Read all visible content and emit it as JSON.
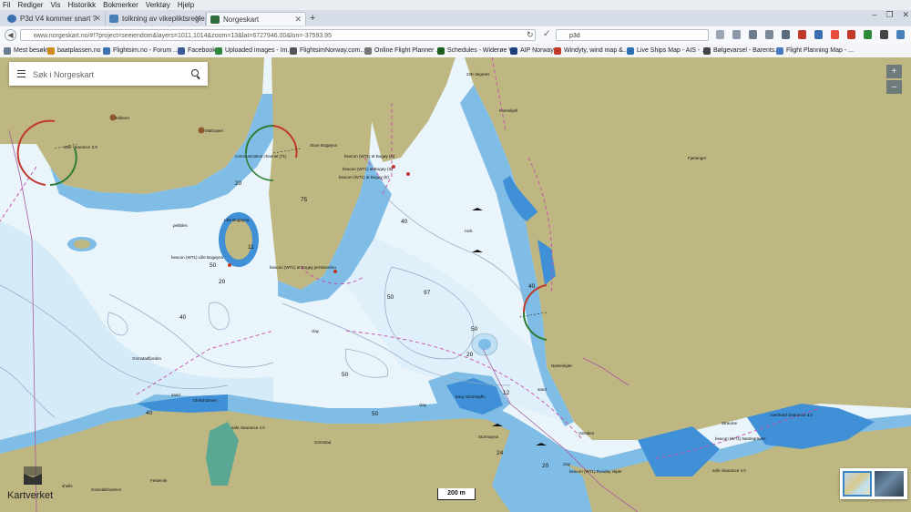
{
  "menubar": [
    "Fil",
    "Rediger",
    "Vis",
    "Historikk",
    "Bokmerker",
    "Verktøy",
    "Hjelp"
  ],
  "tabs": [
    {
      "label": "P3d V4 kommer snart ?",
      "color": "#3a6fb0"
    },
    {
      "label": "tolkning av vikepliktsreglene",
      "color": "#4a80b8"
    },
    {
      "label": "Norgeskart",
      "color": "#2f6e3a"
    }
  ],
  "new_tab": "+",
  "window_buttons": [
    "–",
    "❐",
    "✕"
  ],
  "url": "www.norgeskart.no/#!?project=seeiendom&layers=1011,1014&zoom=13&lat=6727946.00&lon=-37593.95",
  "search_engine_query": "p3d",
  "bookmarks": [
    {
      "label": "Mest besøkt",
      "color": "#6b7b8c"
    },
    {
      "label": "baatplassen.no",
      "color": "#d08a1a"
    },
    {
      "label": "Flightsim.no - Forum ...",
      "color": "#3a6fb0"
    },
    {
      "label": "Facebook",
      "color": "#3b5998"
    },
    {
      "label": "Uploaded images - Im...",
      "color": "#2c8a3a"
    },
    {
      "label": "FlightsimNorway.com...",
      "color": "#555555"
    },
    {
      "label": "Online Flight Planner ...",
      "color": "#777777"
    },
    {
      "label": "Schedules - Widerøe V...",
      "color": "#1b5e20"
    },
    {
      "label": "AIP Norway",
      "color": "#1d3f7a"
    },
    {
      "label": "Windyty, wind map &...",
      "color": "#c0392b"
    },
    {
      "label": "Live Ships Map - AIS - ...",
      "color": "#2d6fb3"
    },
    {
      "label": "Bølgevarsel - Barents...",
      "color": "#444444"
    },
    {
      "label": "Flight Planning Map - ...",
      "color": "#4a7bc0"
    }
  ],
  "map_search": {
    "placeholder": "Søk i Norgeskart"
  },
  "zoom": {
    "in": "+",
    "out": "–"
  },
  "logo_text": "Kartverket",
  "scale_label": "200 m",
  "map_labels": {
    "land": [
      "Killeren",
      "Mathopen",
      "Store Bogøyna",
      "Lille Bogøyna",
      "Grimstadfjorden",
      "Ulriksholmen",
      "Grimstad",
      "Festervik",
      "Grøndalsholmen",
      "Stormøyna",
      "Vøraben",
      "Kviteskjell",
      "Nøsteskjær",
      "Straume",
      "Fjøsanger"
    ],
    "nautical": [
      "safe clearance 3.9",
      "communication channel (71)",
      "beacon (WT1) at Bogøy (N)",
      "beacon (WT1) at Bogøy (S)",
      "beacon (WT1) at Bogøy (E)",
      "beacon (WT1) Lille Bogøyna",
      "beacon (WT1) at Bogøy jernbanebru",
      "pebbles",
      "rock",
      "clay",
      "sand",
      "safe clearance 4.0",
      "buoy Stormøyflu",
      "beacon (WT1) Rundøy skjær",
      "overhead clearance 3.0",
      "beacon (WT1) Nøstegraven",
      "safe clearance 4.0 ",
      "shells",
      "22K degrees"
    ],
    "depths": [
      "20",
      "50",
      "75",
      "40",
      "50",
      "11",
      "20",
      "40",
      "50",
      "97",
      "40",
      "50",
      "20",
      "12",
      "24",
      "50",
      "20",
      "40"
    ]
  },
  "colors": {
    "land": "#bfb782",
    "water_deep": "#e9f4fb",
    "water_mid": "#bfe0f4",
    "water_shallow": "#7fbde6",
    "water_vshallow": "#3f90d6",
    "boundary": "#c64fa7"
  }
}
